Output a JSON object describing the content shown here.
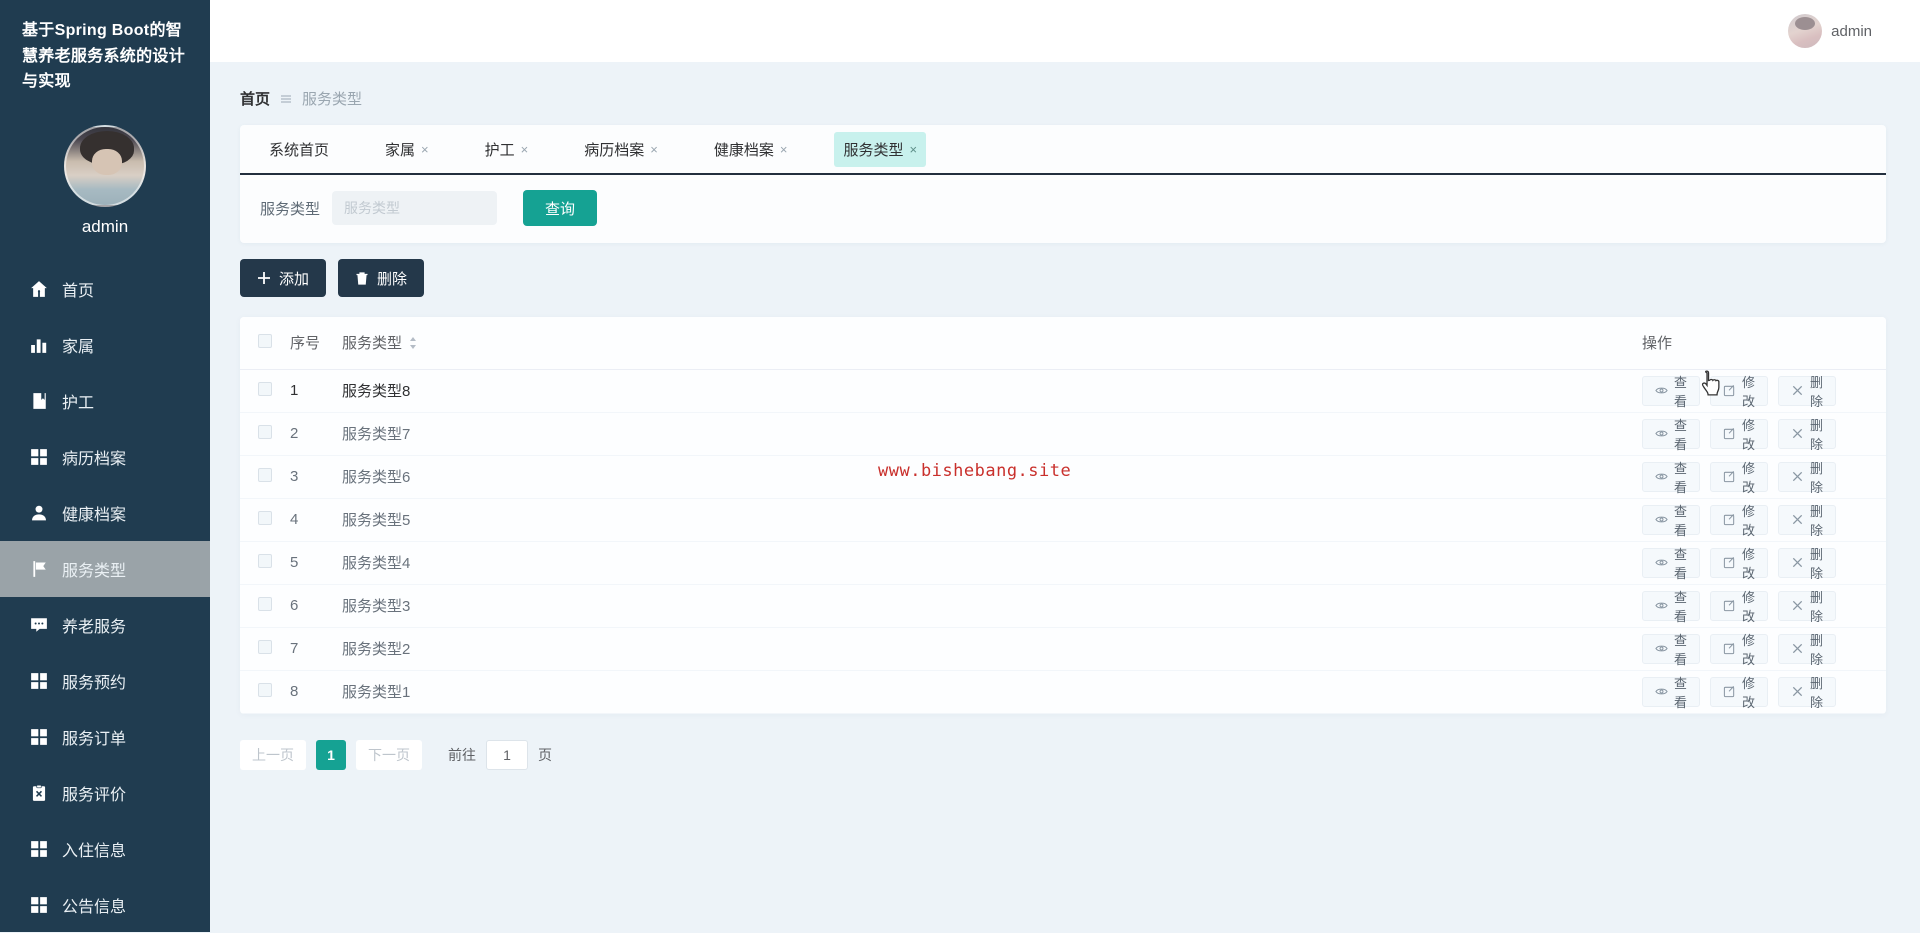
{
  "app": {
    "title": "基于Spring Boot的智慧养老服务系统的设计与实现"
  },
  "topbar": {
    "username": "admin"
  },
  "sidebar": {
    "username": "admin",
    "items": [
      {
        "label": "首页",
        "icon": "home-icon",
        "active": false
      },
      {
        "label": "家属",
        "icon": "bar-chart-icon",
        "active": false
      },
      {
        "label": "护工",
        "icon": "book-icon",
        "active": false
      },
      {
        "label": "病历档案",
        "icon": "grid-icon",
        "active": false
      },
      {
        "label": "健康档案",
        "icon": "user-icon",
        "active": false
      },
      {
        "label": "服务类型",
        "icon": "flag-icon",
        "active": true
      },
      {
        "label": "养老服务",
        "icon": "chat-icon",
        "active": false
      },
      {
        "label": "服务预约",
        "icon": "grid-icon",
        "active": false
      },
      {
        "label": "服务订单",
        "icon": "grid-icon",
        "active": false
      },
      {
        "label": "服务评价",
        "icon": "clipboard-x-icon",
        "active": false
      },
      {
        "label": "入住信息",
        "icon": "grid-icon",
        "active": false
      },
      {
        "label": "公告信息",
        "icon": "grid-icon",
        "active": false
      }
    ]
  },
  "breadcrumb": {
    "home": "首页",
    "current": "服务类型"
  },
  "tabs": [
    {
      "label": "系统首页",
      "closable": false,
      "active": false
    },
    {
      "label": "家属",
      "closable": true,
      "active": false
    },
    {
      "label": "护工",
      "closable": true,
      "active": false
    },
    {
      "label": "病历档案",
      "closable": true,
      "active": false
    },
    {
      "label": "健康档案",
      "closable": true,
      "active": false
    },
    {
      "label": "服务类型",
      "closable": true,
      "active": true
    }
  ],
  "search": {
    "label": "服务类型",
    "placeholder": "服务类型",
    "button": "查询"
  },
  "toolbar": {
    "add": "添加",
    "delete": "删除"
  },
  "table": {
    "headers": {
      "index": "序号",
      "type": "服务类型",
      "actions": "操作"
    },
    "row_actions": {
      "view": "查看",
      "edit": "修改",
      "delete": "删除"
    },
    "rows": [
      {
        "index": "1",
        "type": "服务类型8"
      },
      {
        "index": "2",
        "type": "服务类型7"
      },
      {
        "index": "3",
        "type": "服务类型6"
      },
      {
        "index": "4",
        "type": "服务类型5"
      },
      {
        "index": "5",
        "type": "服务类型4"
      },
      {
        "index": "6",
        "type": "服务类型3"
      },
      {
        "index": "7",
        "type": "服务类型2"
      },
      {
        "index": "8",
        "type": "服务类型1"
      }
    ]
  },
  "pagination": {
    "prev": "上一页",
    "page": "1",
    "next": "下一页",
    "goto_label": "前往",
    "goto_value": "1",
    "unit": "页"
  },
  "watermark": "www.bishebang.site",
  "colors": {
    "accent": "#15A293",
    "sidebar": "#203C50",
    "selected_item": "#9AA3A8",
    "dark_button": "#24384A",
    "active_tab_bg": "#C8F1ED",
    "watermark": "#C9302C"
  }
}
